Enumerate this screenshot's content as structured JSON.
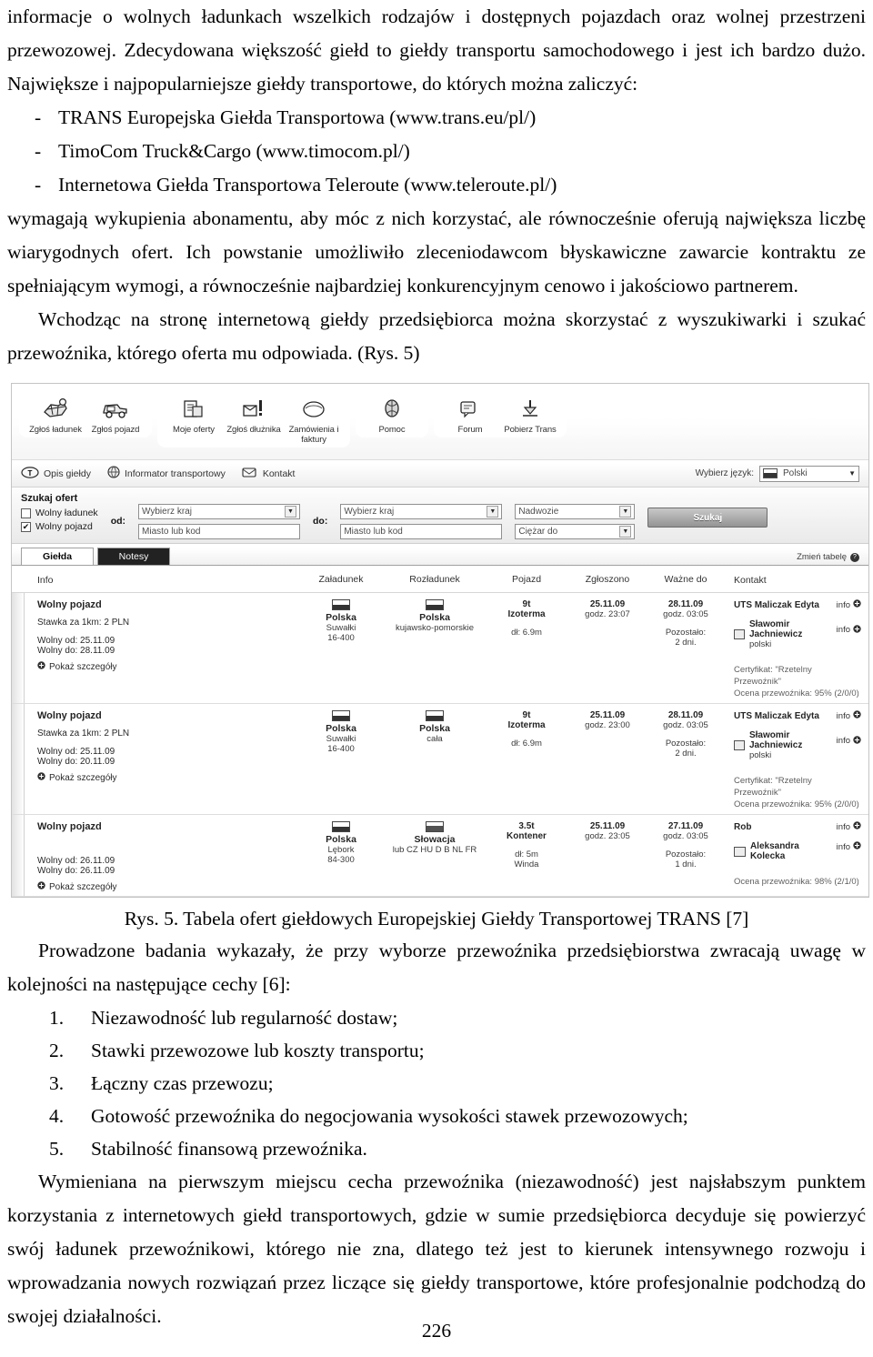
{
  "document": {
    "page_number": "226",
    "paragraphs": {
      "p1": "informacje o wolnych ładunkach wszelkich rodzajów i dostępnych pojazdach oraz wolnej przestrzeni przewozowej. Zdecydowana większość giełd to giełdy transportu samochodowego i jest ich bardzo dużo. Największe i najpopularniejsze giełdy transportowe, do których można zaliczyć:",
      "p2": "wymagają wykupienia abonamentu, aby móc z nich korzystać, ale równocześnie oferują największa liczbę wiarygodnych ofert. Ich powstanie umożliwiło zleceniodawcom błyskawiczne zawarcie kontraktu ze  spełniającym wymogi, a równocześnie najbardziej konkurencyjnym cenowo i jakościowo partnerem.",
      "p3": "Wchodząc na stronę internetową giełdy przedsiębiorca można skorzystać z wyszukiwarki i szukać przewoźnika, którego oferta mu odpowiada. (Rys. 5)",
      "p4": "Prowadzone badania wykazały, że przy wyborze przewoźnika przedsiębiorstwa zwracają uwagę w kolejności na następujące cechy [6]:",
      "p5": "Wymieniana na pierwszym miejscu cecha przewoźnika (niezawodność) jest najsłabszym punktem korzystania z internetowych giełd transportowych, gdzie w sumie przedsiębiorca decyduje się powierzyć swój ładunek przewoźnikowi, którego nie zna, dlatego też jest to kierunek intensywnego rozwoju i wprowadzania nowych rozwiązań przez liczące się giełdy transportowe, które profesjonalnie podchodzą do swojej działalności."
    },
    "exchange_list": [
      {
        "dash": "-",
        "text": "TRANS Europejska Giełda Transportowa (www.trans.eu/pl/)"
      },
      {
        "dash": "-",
        "text": "TimoCom Truck&Cargo (www.timocom.pl/)"
      },
      {
        "dash": "-",
        "text": "Internetowa Giełda Transportowa Teleroute (www.teleroute.pl/)"
      }
    ],
    "criteria_list": [
      {
        "num": "1.",
        "text": "Niezawodność lub regularność dostaw;"
      },
      {
        "num": "2.",
        "text": "Stawki przewozowe lub koszty transportu;"
      },
      {
        "num": "3.",
        "text": "Łączny czas przewozu;"
      },
      {
        "num": "4.",
        "text": "Gotowość przewoźnika do negocjowania wysokości stawek przewozowych;"
      },
      {
        "num": "5.",
        "text": "Stabilność finansową przewoźnika."
      }
    ],
    "figure_caption": "Rys. 5. Tabela ofert giełdowych Europejskiej Giełdy Transportowej TRANS [7]"
  },
  "screenshot": {
    "toolbar": {
      "groups": [
        {
          "buttons": [
            {
              "icon": "cargo-icon",
              "label": "Zgłoś ładunek"
            },
            {
              "icon": "truck-icon",
              "label": "Zgłoś pojazd"
            }
          ]
        },
        {
          "buttons": [
            {
              "icon": "my-offers-icon",
              "label": "Moje oferty"
            },
            {
              "icon": "debtor-icon",
              "label": "Zgłoś dłużnika"
            },
            {
              "icon": "invoices-icon",
              "label": "Zamówienia i faktury"
            }
          ]
        },
        {
          "buttons": [
            {
              "icon": "help-icon",
              "label": "Pomoc"
            }
          ]
        },
        {
          "buttons": [
            {
              "icon": "forum-icon",
              "label": "Forum"
            },
            {
              "icon": "download-icon",
              "label": "Pobierz Trans"
            }
          ]
        }
      ]
    },
    "subnav": {
      "items": [
        {
          "icon": "t-logo-icon",
          "label": "Opis giełdy"
        },
        {
          "icon": "globe-icon",
          "label": "Informator transportowy"
        },
        {
          "icon": "contact-icon",
          "label": "Kontakt"
        }
      ],
      "language_label": "Wybierz język:",
      "language_value": "Polski"
    },
    "search": {
      "title": "Szukaj ofert",
      "checkbox_cargo": {
        "label": "Wolny ładunek",
        "checked": false
      },
      "checkbox_vehicle": {
        "label": "Wolny pojazd",
        "checked": true,
        "mark": "✔"
      },
      "from_legend": "od:",
      "to_legend": "do:",
      "country_placeholder": "Wybierz kraj",
      "city_placeholder": "Miasto lub kod",
      "body_placeholder": "Nadwozie",
      "weight_placeholder": "Ciężar do",
      "search_button": "Szukaj"
    },
    "tabs": {
      "items": [
        {
          "label": "Giełda",
          "active": true
        },
        {
          "label": "Notesy",
          "active": false
        }
      ],
      "change_table": "Zmień tabelę"
    },
    "table": {
      "headers": [
        "Info",
        "Załadunek",
        "Rozładunek",
        "Pojazd",
        "Zgłoszono",
        "Ważne do",
        "Kontakt"
      ],
      "rows": [
        {
          "info_title": "Wolny pojazd",
          "info_rate": "Stawka za 1km: 2 PLN",
          "info_free_from": "Wolny od: 25.11.09",
          "info_free_to": "Wolny do: 28.11.09",
          "details_link": "Pokaż szczegóły",
          "load_country": "Polska",
          "load_city": "Suwałki",
          "load_code": "16-400",
          "unload_country": "Polska",
          "unload_city": "kujawsko-pomorskie",
          "unload_code": "",
          "vehicle_weight": "9t",
          "vehicle_type": "Izoterma",
          "vehicle_len": "dł: 6.9m",
          "reported_date": "25.11.09",
          "reported_time": "godz. 23:07",
          "valid_date": "28.11.09",
          "valid_time": "godz. 03:05",
          "valid_left_label": "Pozostało:",
          "valid_left": "2 dni.",
          "company": "UTS Maliczak Edyta",
          "person": "Sławomir Jachniewicz",
          "person_lang": "polski",
          "info_label_1": "info",
          "info_label_2": "info",
          "certificate": "Certyfikat: \"Rzetelny Przewoźnik\"",
          "rating": "Ocena przewoźnika: 95% (2/0/0)"
        },
        {
          "info_title": "Wolny pojazd",
          "info_rate": "Stawka za 1km: 2 PLN",
          "info_free_from": "Wolny od: 25.11.09",
          "info_free_to": "Wolny do: 20.11.09",
          "details_link": "Pokaż szczegóły",
          "load_country": "Polska",
          "load_city": "Suwałki",
          "load_code": "16-400",
          "unload_country": "Polska",
          "unload_city": "cała",
          "unload_code": "",
          "vehicle_weight": "9t",
          "vehicle_type": "Izoterma",
          "vehicle_len": "dł: 6.9m",
          "reported_date": "25.11.09",
          "reported_time": "godz. 23:00",
          "valid_date": "28.11.09",
          "valid_time": "godz. 03:05",
          "valid_left_label": "Pozostało:",
          "valid_left": "2 dni.",
          "company": "UTS Maliczak Edyta",
          "person": "Sławomir Jachniewicz",
          "person_lang": "polski",
          "info_label_1": "info",
          "info_label_2": "info",
          "certificate": "Certyfikat: \"Rzetelny Przewoźnik\"",
          "rating": "Ocena przewoźnika: 95% (2/0/0)"
        },
        {
          "info_title": "Wolny pojazd",
          "info_rate": "",
          "info_free_from": "Wolny od: 26.11.09",
          "info_free_to": "Wolny do: 26.11.09",
          "details_link": "Pokaż szczegóły",
          "load_country": "Polska",
          "load_city": "Lębork",
          "load_code": "84-300",
          "unload_country": "Słowacja",
          "unload_city": "lub CZ HU D B NL FR",
          "unload_code": "",
          "vehicle_weight": "3.5t",
          "vehicle_type": "Kontener",
          "vehicle_len": "dł: 5m",
          "vehicle_extra": "Winda",
          "reported_date": "25.11.09",
          "reported_time": "godz. 23:05",
          "valid_date": "27.11.09",
          "valid_time": "godz. 03:05",
          "valid_left_label": "Pozostało:",
          "valid_left": "1 dni.",
          "company": "Rob",
          "person": "Aleksandra Kolecka",
          "person_lang": "",
          "info_label_1": "info",
          "info_label_2": "info",
          "certificate": "",
          "rating": "Ocena przewoźnika: 98% (2/1/0)"
        }
      ]
    }
  }
}
